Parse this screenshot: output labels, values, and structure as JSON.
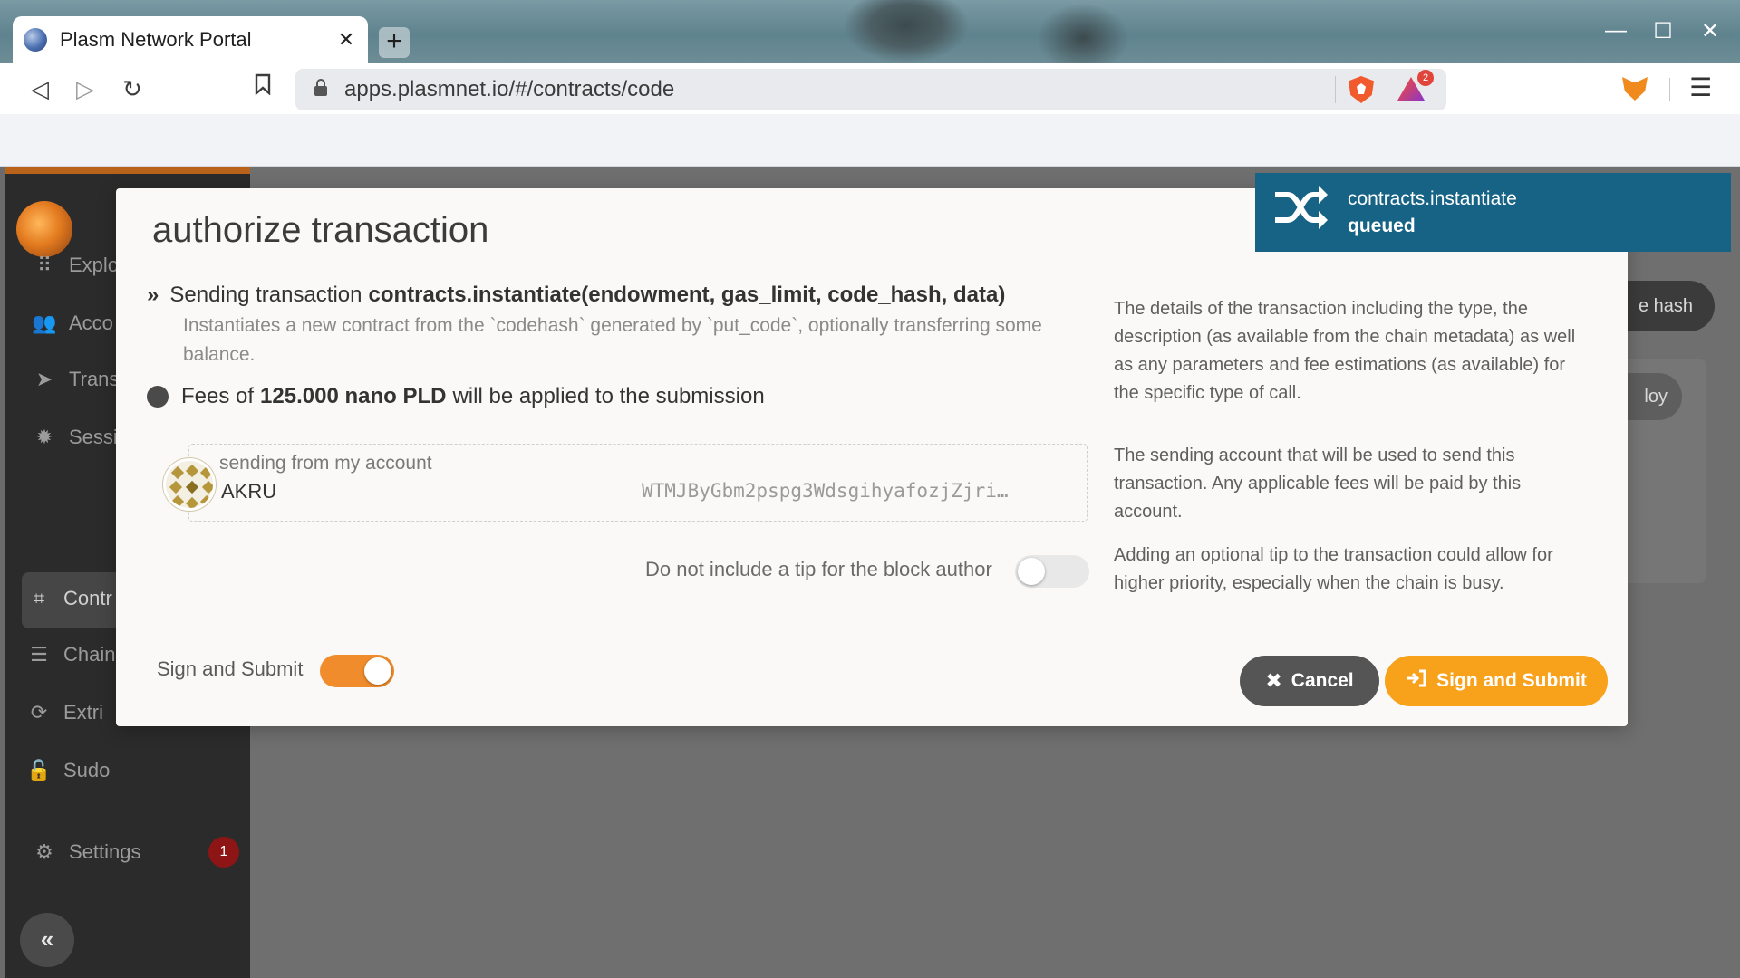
{
  "browser": {
    "tab_title": "Plasm Network Portal",
    "tab_close": "✕",
    "new_tab": "+",
    "url": "apps.plasmnet.io/#/contracts/code",
    "notification_count": "2",
    "window_minimize": "—",
    "window_maximize": "☐",
    "window_close": "✕",
    "nav_back_icon": "◁",
    "nav_forward_icon": "▷",
    "reload_icon": "↻",
    "bookmark_icon": "🔖",
    "menu_icon": "☰"
  },
  "sidebar": {
    "items": [
      {
        "label": "Explo",
        "icon": "grid-icon",
        "glyph": "⠿"
      },
      {
        "label": "Acco",
        "icon": "users-icon",
        "glyph": "👥"
      },
      {
        "label": "Trans",
        "icon": "send-icon",
        "glyph": "➤"
      },
      {
        "label": "Sessi",
        "icon": "gear-icon",
        "glyph": "✹"
      },
      {
        "label": "Contr",
        "icon": "contracts-icon",
        "glyph": "⌗"
      },
      {
        "label": "Chain",
        "icon": "database-icon",
        "glyph": "☰"
      },
      {
        "label": "Extri",
        "icon": "sync-icon",
        "glyph": "⟳"
      },
      {
        "label": "Sudo",
        "icon": "unlock-icon",
        "glyph": "🔓"
      },
      {
        "label": "Settings",
        "icon": "settings-icon",
        "glyph": "⚙"
      }
    ],
    "settings_badge": "1",
    "collapse_glyph": "«"
  },
  "background": {
    "hash_button": "e hash",
    "deploy_button": "loy",
    "help_glyph": "?"
  },
  "modal": {
    "title": "authorize transaction",
    "send_prefix": "Sending transaction",
    "send_call": "contracts.instantiate(endowment, gas_limit, code_hash, data)",
    "description": "Instantiates a new contract from the `codehash` generated by `put_code`, optionally transferring some balance.",
    "fee_prefix": "Fees of",
    "fee_amount": "125.000 nano PLD",
    "fee_suffix": "will be applied to the submission",
    "account_label": "sending from my account",
    "account_name": "AKRU",
    "account_address": "WTMJByGbm2pspg3WdsgihyafozjZjri…",
    "tip_label": "Do not include a tip for the block author",
    "tip_enabled": false,
    "sign_toggle_label": "Sign and Submit",
    "sign_toggle_on": true,
    "help_details": "The details of the transaction including the type, the description (as available from the chain metadata) as well as any parameters and fee estimations (as available) for the specific type of call.",
    "help_account": "The sending account that will be used to send this transaction. Any applicable fees will be paid by this account.",
    "help_tip": "Adding an optional tip to the transaction could allow for higher priority, especially when the chain is busy.",
    "cancel_label": "Cancel",
    "submit_label": "Sign and Submit"
  },
  "toast": {
    "title": "contracts.instantiate",
    "status": "queued"
  },
  "colors": {
    "accent": "#f8a21c",
    "toast_bg": "#176386",
    "sidebar_bg": "#2b2b2b",
    "badge": "#8e1515"
  }
}
